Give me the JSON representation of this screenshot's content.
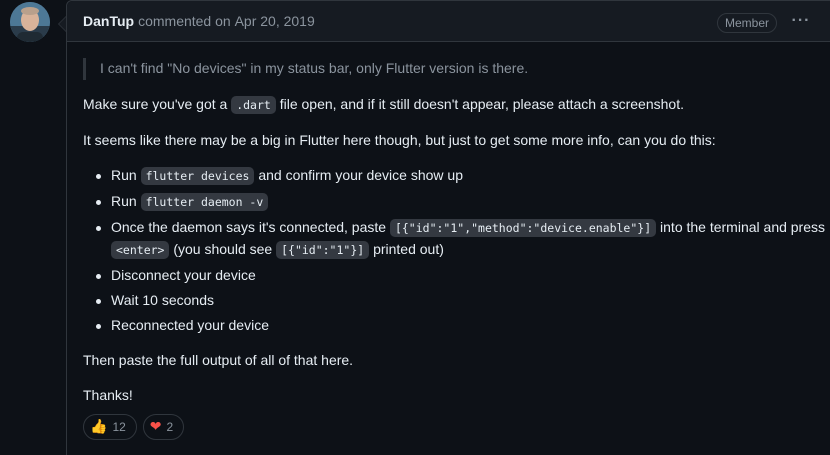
{
  "comment": {
    "author": "DanTup",
    "action": "commented on",
    "date": "Apr 20, 2019",
    "badge": "Member",
    "menu_icon": "kebab-horizontal-icon"
  },
  "body": {
    "quote": "I can't find \"No devices\" in my status bar, only Flutter version is there.",
    "p1_before": "Make sure you've got a ",
    "p1_code": ".dart",
    "p1_after": " file open, and if it still doesn't appear, please attach a screenshot.",
    "p2": "It seems like there may be a big in Flutter here though, but just to get some more info, can you do this:",
    "items": {
      "i0_a": "Run ",
      "i0_code": "flutter devices",
      "i0_b": " and confirm your device show up",
      "i1_a": "Run ",
      "i1_code": "flutter daemon -v",
      "i2_a": "Once the daemon says it's connected, paste ",
      "i2_code": "[{\"id\":\"1\",\"method\":\"device.enable\"}]",
      "i2_b": " into the terminal and press ",
      "i2_code2": "<enter>",
      "i2_c": " (you should see ",
      "i2_code3": "[{\"id\":\"1\"}]",
      "i2_d": " printed out)",
      "i3": "Disconnect your device",
      "i4": "Wait 10 seconds",
      "i5": "Reconnected your device"
    },
    "p3": "Then paste the full output of all of that here.",
    "p4": "Thanks!"
  },
  "reactions": [
    {
      "emoji": "👍",
      "icon": "thumbs-up-icon",
      "count": "12"
    },
    {
      "emoji": "❤",
      "icon": "heart-icon",
      "count": "2",
      "color": "#f85149"
    }
  ]
}
